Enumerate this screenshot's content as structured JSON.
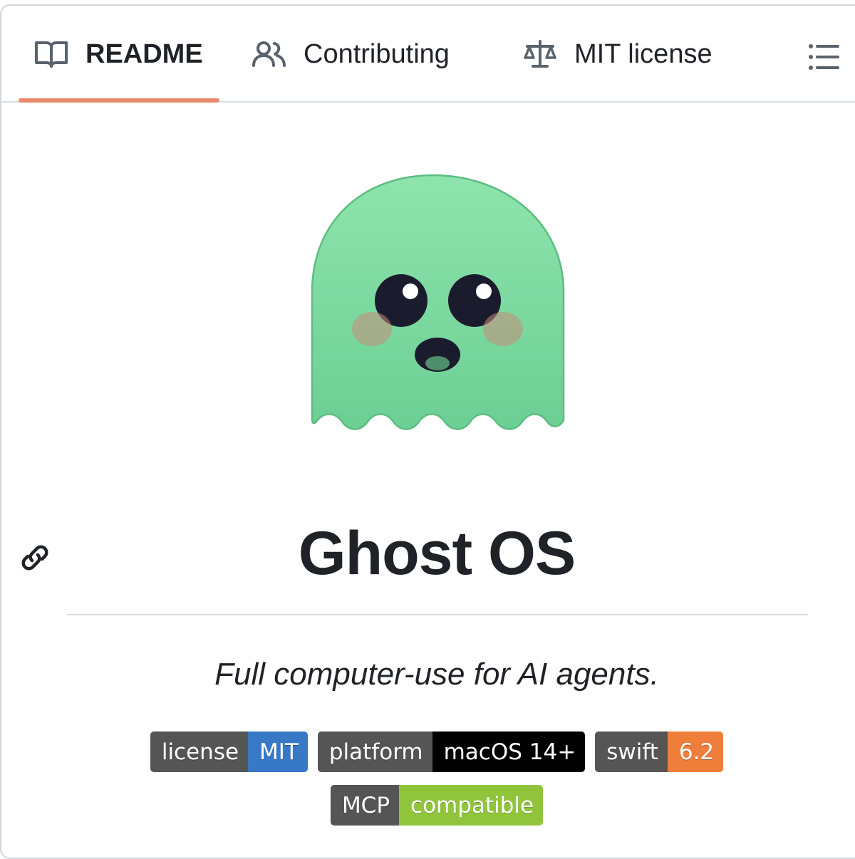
{
  "tabs": [
    {
      "label": "README",
      "icon": "book-icon",
      "active": true
    },
    {
      "label": "Contributing",
      "icon": "people-icon",
      "active": false
    },
    {
      "label": "MIT license",
      "icon": "law-icon",
      "active": false
    }
  ],
  "toc_icon": "list-unordered-icon",
  "readme": {
    "logo_icon": "ghost-logo",
    "title": "Ghost OS",
    "tagline": "Full computer-use for AI agents.",
    "badges": [
      {
        "label": "license",
        "value": "MIT",
        "color": "#3779c5"
      },
      {
        "label": "platform",
        "value": "macOS 14+",
        "color": "#000000"
      },
      {
        "label": "swift",
        "value": "6.2",
        "color": "#f07e3b"
      },
      {
        "label": "MCP",
        "value": "compatible",
        "color": "#90c53b"
      }
    ]
  },
  "colors": {
    "tab_underline": "#e98a6a",
    "ghost_body": "#7ed9a0"
  }
}
